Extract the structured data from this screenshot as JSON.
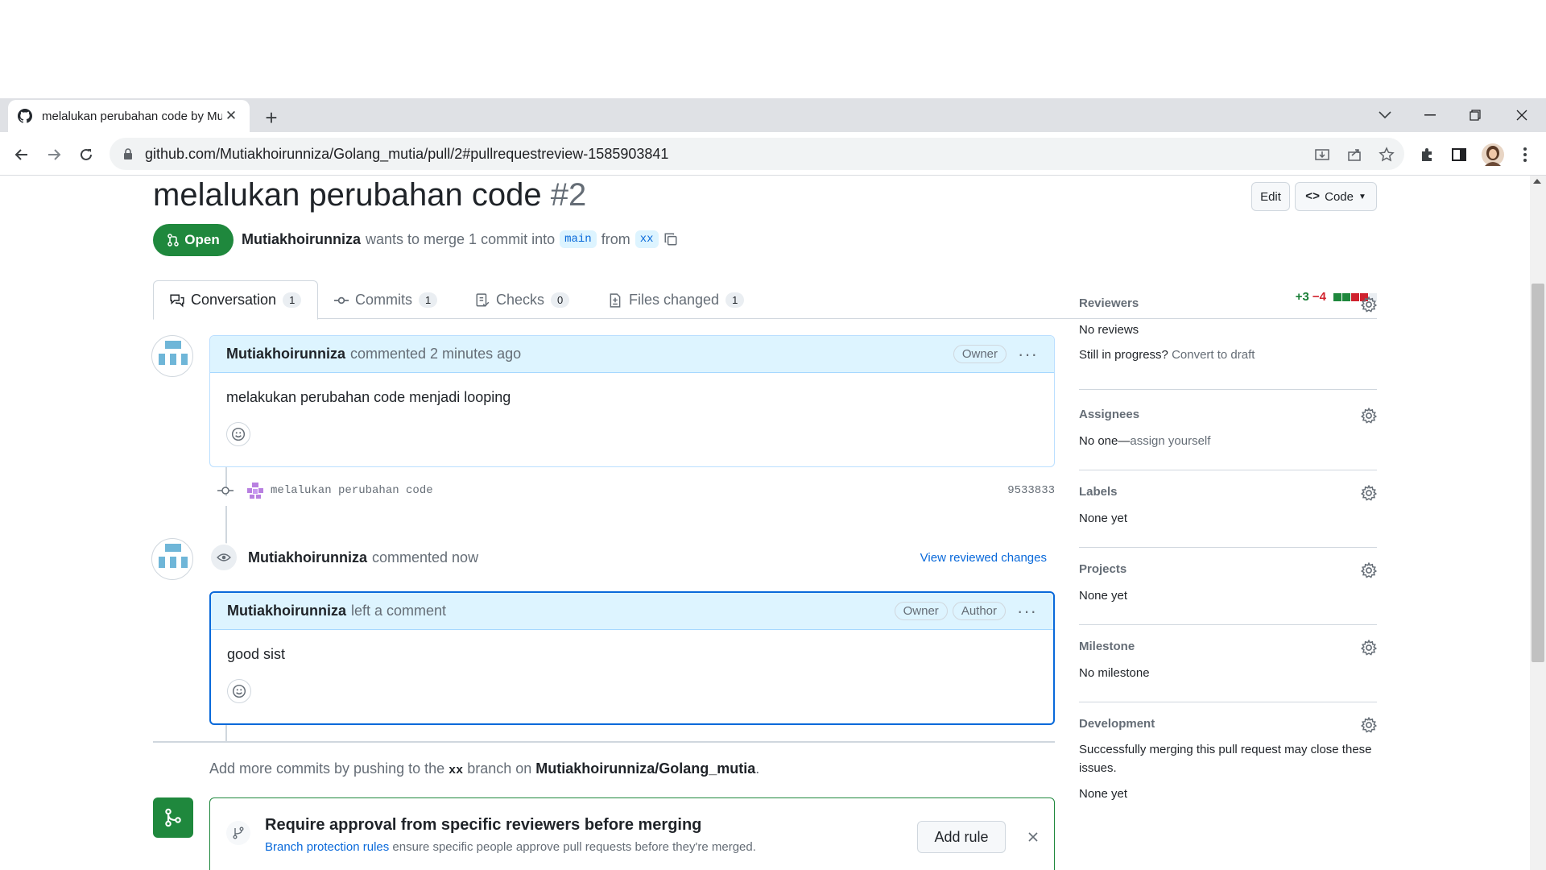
{
  "browser": {
    "tab_title": "melalukan perubahan code by Mutiakhoirunniza",
    "url": "github.com/Mutiakhoirunniza/Golang_mutia/pull/2#pullrequestreview-1585903841"
  },
  "pr": {
    "title": "melalukan perubahan code",
    "number": "#2",
    "edit_label": "Edit",
    "code_label": "Code",
    "state": "Open",
    "author": "Mutiakhoirunniza",
    "merge_text": "wants to merge 1 commit into",
    "base_branch": "main",
    "from_text": "from",
    "head_branch": "xx"
  },
  "tabs": [
    {
      "label": "Conversation",
      "count": "1"
    },
    {
      "label": "Commits",
      "count": "1"
    },
    {
      "label": "Checks",
      "count": "0"
    },
    {
      "label": "Files changed",
      "count": "1"
    }
  ],
  "diffstat": {
    "additions": "+3",
    "deletions": "−4"
  },
  "comment1": {
    "author": "Mutiakhoirunniza",
    "action": "commented 2 minutes ago",
    "badge": "Owner",
    "body": "melakukan perubahan code menjadi looping"
  },
  "commit": {
    "message": "melalukan perubahan code",
    "sha": "9533833"
  },
  "review": {
    "author": "Mutiakhoirunniza",
    "action": "commented now",
    "link": "View reviewed changes"
  },
  "comment2": {
    "author": "Mutiakhoirunniza",
    "action": "left a comment",
    "badge_owner": "Owner",
    "badge_author": "Author",
    "body": "good sist"
  },
  "sidebar": {
    "reviewers": {
      "title": "Reviewers",
      "text": "No reviews",
      "progress": "Still in progress?",
      "draft_link": "Convert to draft"
    },
    "assignees": {
      "title": "Assignees",
      "text": "No one—",
      "link": "assign yourself"
    },
    "labels": {
      "title": "Labels",
      "text": "None yet"
    },
    "projects": {
      "title": "Projects",
      "text": "None yet"
    },
    "milestone": {
      "title": "Milestone",
      "text": "No milestone"
    },
    "development": {
      "title": "Development",
      "text": "Successfully merging this pull request may close these issues.",
      "none": "None yet"
    }
  },
  "footer": {
    "add_more_1": "Add more commits by pushing to the",
    "branch": "xx",
    "add_more_2": "branch on",
    "repo": "Mutiakhoirunniza/Golang_mutia",
    "period": "."
  },
  "rule": {
    "title": "Require approval from specific reviewers before merging",
    "link": "Branch protection rules",
    "text": "ensure specific people approve pull requests before they're merged.",
    "button": "Add rule"
  }
}
